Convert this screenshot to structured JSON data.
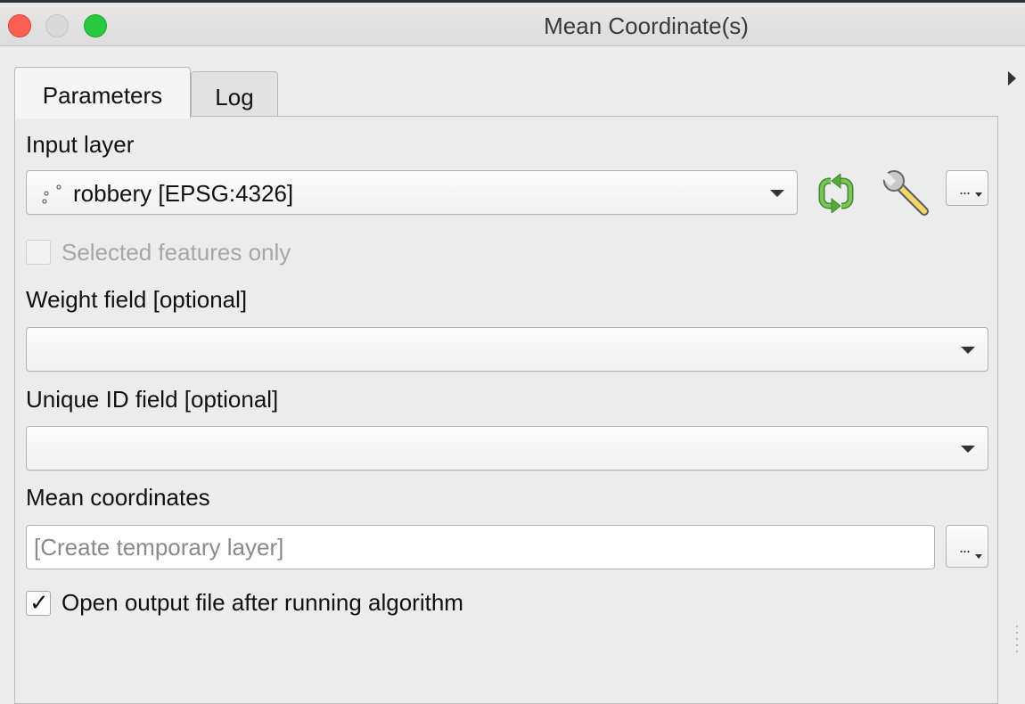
{
  "window": {
    "title": "Mean Coordinate(s)"
  },
  "tabs": [
    {
      "label": "Parameters",
      "active": true
    },
    {
      "label": "Log",
      "active": false
    }
  ],
  "params": {
    "input_layer": {
      "label": "Input layer",
      "value": "robbery [EPSG:4326]",
      "layer_icon": "point-layer-icon",
      "iterate_icon": "iterate-over-features-icon",
      "advanced_icon": "wrench-icon",
      "more_label": "..."
    },
    "selected_only": {
      "label": "Selected features only",
      "checked": false,
      "enabled": false
    },
    "weight_field": {
      "label": "Weight field [optional]",
      "value": ""
    },
    "unique_id_field": {
      "label": "Unique ID field [optional]",
      "value": ""
    },
    "output": {
      "label": "Mean coordinates",
      "placeholder": "[Create temporary layer]",
      "more_label": "..."
    },
    "open_output": {
      "label": "Open output file after running algorithm",
      "checked": true,
      "mark": "✓"
    }
  },
  "colors": {
    "close": "#fe5f57",
    "minimize": "#d9d9d9",
    "maximize": "#28c940",
    "iterate_green": "#5aa83a"
  }
}
